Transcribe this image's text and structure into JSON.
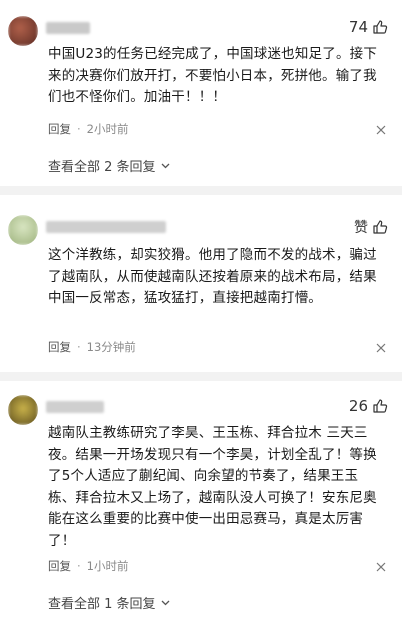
{
  "comments": [
    {
      "likes": "74",
      "text": "中国U23的任务已经完成了，中国球迷也知足了。接下来的决赛你们放开打，不要怕小日本，死拼他。输了我们也不怪你们。加油干！！！",
      "reply_label": "回复",
      "time": "2小时前",
      "view_replies": "查看全部 2 条回复"
    },
    {
      "like_label": "赞",
      "text": "这个洋教练，却实狡猾。他用了隐而不发的战术，骗过了越南队，从而使越南队还按着原来的战术布局，结果中国一反常态，猛攻猛打，直接把越南打懵。",
      "reply_label": "回复",
      "time": "13分钟前"
    },
    {
      "likes": "26",
      "text": "越南队主教练研究了李昊、王玉栋、拜合拉木 三天三夜。结果一开场发现只有一个李昊，计划全乱了！等换了5个人适应了蒯纪闻、向余望的节奏了，结果王玉栋、拜合拉木又上场了，越南队没人可换了！安东尼奥能在这么重要的比赛中使一出田忌赛马，真是太厉害了！",
      "reply_label": "回复",
      "time": "1小时前",
      "view_replies": "查看全部 1 条回复"
    }
  ],
  "icons": [
    "thumb-up-icon",
    "more-options-icon",
    "chevron-down-icon"
  ],
  "colors": {
    "separator": "#f2f2f2",
    "meta_text": "#8a8a8a",
    "body_text": "#1a1a1a"
  }
}
